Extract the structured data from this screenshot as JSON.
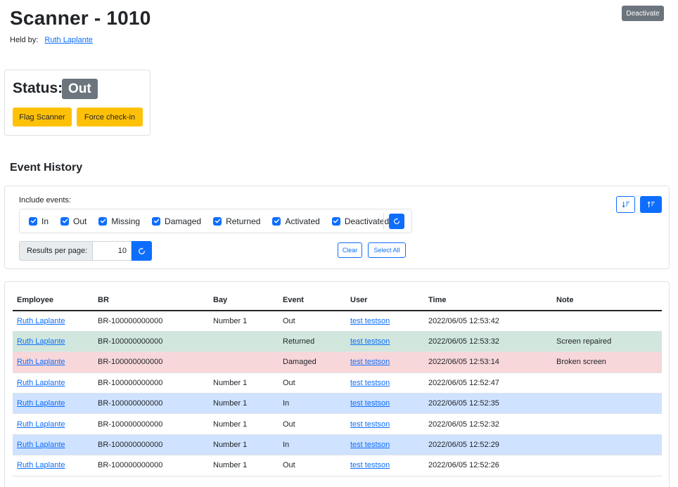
{
  "header": {
    "title": "Scanner - 1010",
    "held_by_label": "Held by:",
    "held_by_name": "Ruth Laplante",
    "deactivate_label": "Deactivate"
  },
  "status": {
    "label": "Status:",
    "value": "Out",
    "flag_label": "Flag Scanner",
    "force_label": "Force check-in"
  },
  "history": {
    "title": "Event History",
    "include_label": "Include events:",
    "events": [
      {
        "label": "In",
        "checked": true
      },
      {
        "label": "Out",
        "checked": true
      },
      {
        "label": "Missing",
        "checked": true
      },
      {
        "label": "Damaged",
        "checked": true
      },
      {
        "label": "Returned",
        "checked": true
      },
      {
        "label": "Activated",
        "checked": true
      },
      {
        "label": "Deactivated",
        "checked": true
      }
    ],
    "results_per_page_label": "Results per page:",
    "results_per_page_value": "10",
    "clear_label": "Clear",
    "select_all_label": "Select All"
  },
  "table": {
    "columns": [
      "Employee",
      "BR",
      "Bay",
      "Event",
      "User",
      "Time",
      "Note"
    ],
    "rows": [
      {
        "employee": "Ruth Laplante",
        "br": "BR-100000000000",
        "bay": "Number 1",
        "event": "Out",
        "user": "test testson",
        "time": "2022/06/05 12:53:42",
        "note": "",
        "style": "plain"
      },
      {
        "employee": "Ruth Laplante",
        "br": "BR-100000000000",
        "bay": "",
        "event": "Returned",
        "user": "test testson",
        "time": "2022/06/05 12:53:32",
        "note": "Screen repaired",
        "style": "success"
      },
      {
        "employee": "Ruth Laplante",
        "br": "BR-100000000000",
        "bay": "",
        "event": "Damaged",
        "user": "test testson",
        "time": "2022/06/05 12:53:14",
        "note": "Broken screen",
        "style": "danger"
      },
      {
        "employee": "Ruth Laplante",
        "br": "BR-100000000000",
        "bay": "Number 1",
        "event": "Out",
        "user": "test testson",
        "time": "2022/06/05 12:52:47",
        "note": "",
        "style": "plain"
      },
      {
        "employee": "Ruth Laplante",
        "br": "BR-100000000000",
        "bay": "Number 1",
        "event": "In",
        "user": "test testson",
        "time": "2022/06/05 12:52:35",
        "note": "",
        "style": "primary"
      },
      {
        "employee": "Ruth Laplante",
        "br": "BR-100000000000",
        "bay": "Number 1",
        "event": "Out",
        "user": "test testson",
        "time": "2022/06/05 12:52:32",
        "note": "",
        "style": "plain"
      },
      {
        "employee": "Ruth Laplante",
        "br": "BR-100000000000",
        "bay": "Number 1",
        "event": "In",
        "user": "test testson",
        "time": "2022/06/05 12:52:29",
        "note": "",
        "style": "primary"
      },
      {
        "employee": "Ruth Laplante",
        "br": "BR-100000000000",
        "bay": "Number 1",
        "event": "Out",
        "user": "test testson",
        "time": "2022/06/05 12:52:26",
        "note": "",
        "style": "plain"
      }
    ]
  },
  "colors": {
    "primary": "#0d6efd",
    "secondary": "#6c757d",
    "warning": "#ffc107",
    "success_row": "#d1e7dd",
    "danger_row": "#f8d7da",
    "primary_row": "#cfe2ff"
  },
  "icons": {
    "refresh": "refresh-icon",
    "sort_ascending": "sort-ascending-icon",
    "sort_descending": "sort-descending-icon",
    "check": "check-icon"
  }
}
